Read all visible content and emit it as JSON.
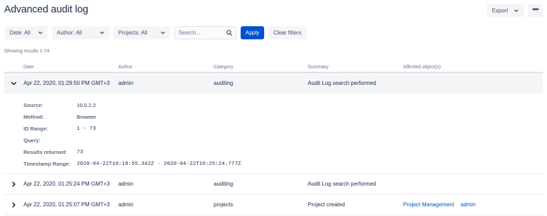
{
  "page": {
    "title": "Advanced audit log"
  },
  "header": {
    "export_label": "Export",
    "more_label": "•••"
  },
  "filters": {
    "date": "Date: All",
    "author": "Author: All",
    "projects": "Projects: All",
    "search_placeholder": "Search...",
    "apply_label": "Apply",
    "clear_label": "Clear filters"
  },
  "results": {
    "count_text": "Showing results 1-74"
  },
  "table": {
    "columns": [
      "Date",
      "Author",
      "Category",
      "Summary",
      "Affected object(s)"
    ],
    "rows": [
      {
        "date": "Apr 22, 2020, 01:29:50 PM GMT+3",
        "author": "admin",
        "category": "auditing",
        "summary": "Audit Log search performed",
        "expanded": true
      },
      {
        "date": "Apr 22, 2020, 01:25:24 PM GMT+3",
        "author": "admin",
        "category": "auditing",
        "summary": "Audit Log search performed",
        "expanded": false
      },
      {
        "date": "Apr 22, 2020, 01:25:07 PM GMT+3",
        "author": "admin",
        "category": "projects",
        "summary": "Project created",
        "expanded": false,
        "affected": [
          "Project Management",
          "admin"
        ]
      }
    ]
  },
  "details": {
    "source_label": "Source:",
    "source_value": "10.0.2.2",
    "method_label": "Method:",
    "method_value": "Browser",
    "id_range_label": "ID Range:",
    "id_range_value": "1 - 73",
    "query_label": "Query:",
    "query_value": "",
    "results_label": "Results returned:",
    "results_value": "73",
    "timestamp_label": "Timestamp Range:",
    "timestamp_value": "2020-04-22T10:18:55.342Z - 2020-04-22T10:25:24.777Z"
  },
  "colors": {
    "primary": "#0052cc",
    "text": "#172b4d",
    "muted": "#6b778c",
    "button_bg": "#f4f5f7",
    "link": "#0052cc"
  }
}
